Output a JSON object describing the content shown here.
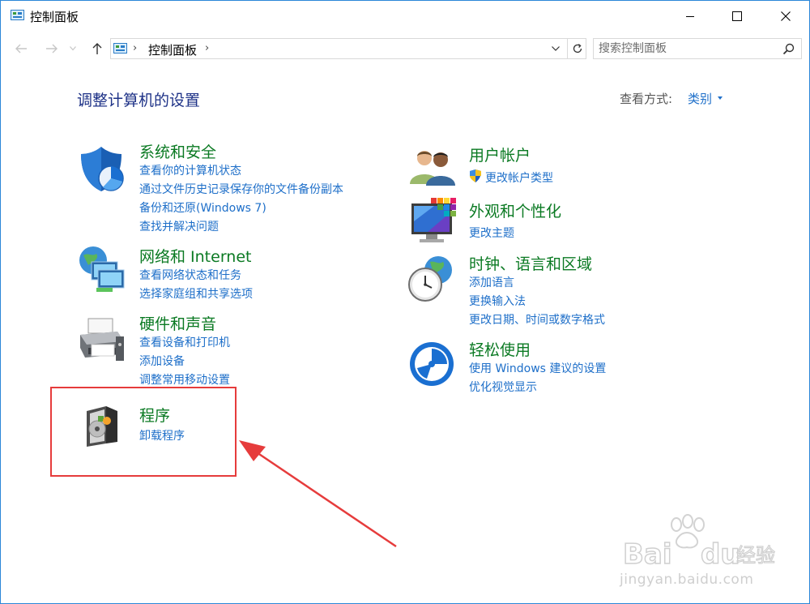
{
  "window": {
    "title": "控制面板"
  },
  "address": {
    "path": "控制面板",
    "search_placeholder": "搜索控制面板"
  },
  "page": {
    "title": "调整计算机的设置",
    "view_by_label": "查看方式:",
    "view_by_value": "类别"
  },
  "categories": {
    "system": {
      "title": "系统和安全",
      "links": [
        "查看你的计算机状态",
        "通过文件历史记录保存你的文件备份副本",
        "备份和还原(Windows 7)",
        "查找并解决问题"
      ]
    },
    "network": {
      "title": "网络和 Internet",
      "links": [
        "查看网络状态和任务",
        "选择家庭组和共享选项"
      ]
    },
    "hardware": {
      "title": "硬件和声音",
      "links": [
        "查看设备和打印机",
        "添加设备",
        "调整常用移动设置"
      ]
    },
    "programs": {
      "title": "程序",
      "links": [
        "卸载程序"
      ]
    },
    "accounts": {
      "title": "用户帐户",
      "links": [
        "更改帐户类型"
      ]
    },
    "appearance": {
      "title": "外观和个性化",
      "links": [
        "更改主题"
      ]
    },
    "clock": {
      "title": "时钟、语言和区域",
      "links": [
        "添加语言",
        "更换输入法",
        "更改日期、时间或数字格式"
      ]
    },
    "ease": {
      "title": "轻松使用",
      "links": [
        "使用 Windows 建议的设置",
        "优化视觉显示"
      ]
    }
  },
  "watermark": {
    "brand": "Bai du 经验",
    "url": "jingyan.baidu.com"
  },
  "colors": {
    "accent_border": "#2b87d8",
    "category_title": "#0b7a23",
    "link": "#1e6fc9",
    "heading": "#1e3287",
    "highlight": "#e63c3c"
  }
}
